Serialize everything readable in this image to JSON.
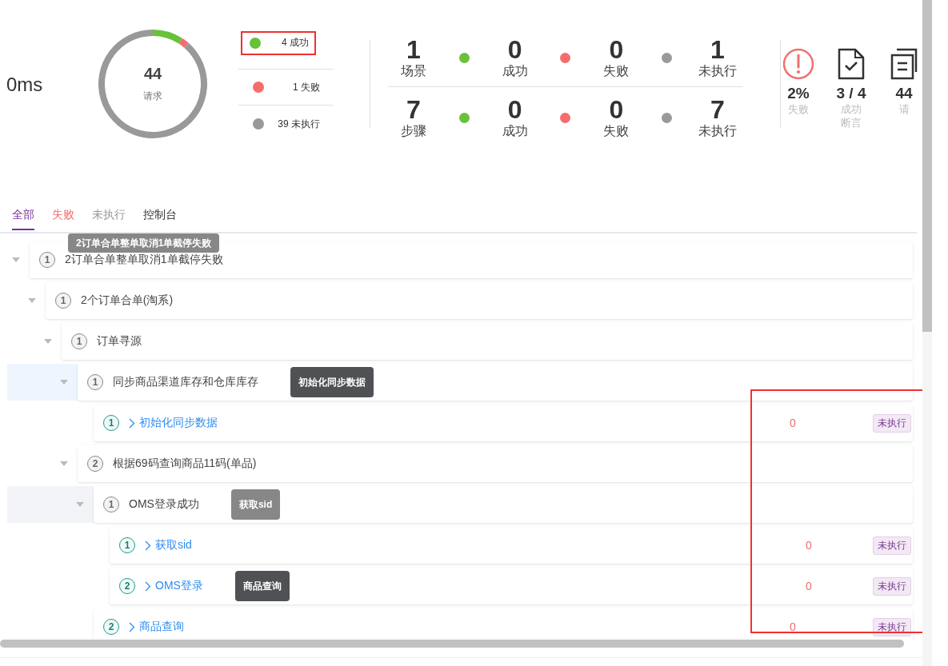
{
  "duration": "0ms",
  "request_chart": {
    "total": "44",
    "chart_data": {
      "type": "donut",
      "categories": [
        "4 成功",
        "1 失败",
        "39 未执行"
      ],
      "series": [
        {
          "name": "请求",
          "values": [
            4,
            1,
            39
          ]
        }
      ]
    }
  },
  "legend": [
    {
      "color": "#67c23a",
      "highlighted": true
    },
    {
      "color": "#f56c6c",
      "highlighted": false
    },
    {
      "color": "#999999",
      "highlighted": false
    }
  ],
  "stats": [
    [
      {
        "value": "1",
        "label": "场景"
      },
      {
        "value": "0",
        "label": "成功",
        "color": "#67c23a"
      },
      {
        "value": "0",
        "label": "失败",
        "color": "#f56c6c"
      },
      {
        "value": "1",
        "label": "未执行",
        "color": "#999999"
      }
    ],
    [
      {
        "value": "7",
        "label": "步骤"
      },
      {
        "value": "0",
        "label": "成功",
        "color": "#67c23a"
      },
      {
        "value": "0",
        "label": "失败",
        "color": "#f56c6c"
      },
      {
        "value": "7",
        "label": "未执行",
        "color": "#999999"
      }
    ]
  ],
  "summary": [
    {
      "kind": "alert",
      "value": "2%",
      "label": "失败"
    },
    {
      "kind": "file-check",
      "value": "3 / 4",
      "label": "成功断言"
    },
    {
      "kind": "clipboard",
      "value": "44",
      "label": "请"
    }
  ],
  "tabs": [
    {
      "label": "全部",
      "selected": true,
      "color": "#7b2fa0"
    },
    {
      "label": "失败",
      "selected": false,
      "color": "#f56c6c"
    },
    {
      "label": "未执行",
      "selected": false,
      "color": "#999999"
    },
    {
      "label": "控制台",
      "selected": false,
      "color": "#333333"
    }
  ],
  "highlight_result_column": true,
  "tree": [
    {
      "kind": "group",
      "number": "1",
      "title": "2订单合单整单取消1单截停失败",
      "expanded": true,
      "selected": false,
      "hovered": false,
      "tooltip": {
        "text": "2订单合单整单取消1单截停失败",
        "kind": "light"
      },
      "children": [
        {
          "kind": "group",
          "number": "1",
          "title": "2个订单合单(淘系)",
          "expanded": true,
          "selected": false,
          "hovered": false,
          "children": [
            {
              "kind": "group",
              "number": "1",
              "title": "订单寻源",
              "expanded": true,
              "selected": false,
              "hovered": false,
              "children": [
                {
                  "kind": "group",
                  "number": "1",
                  "title": "同步商品渠道库存和仓库库存",
                  "expanded": true,
                  "selected": true,
                  "hovered": false,
                  "tooltip": {
                    "text": "初始化同步数据",
                    "kind": "dark"
                  },
                  "children": [
                    {
                      "kind": "step",
                      "number": "1",
                      "title": "初始化同步数据",
                      "count": "0",
                      "status": "未执行"
                    }
                  ]
                },
                {
                  "kind": "group",
                  "number": "2",
                  "title": "根据69码查询商品11码(单品)",
                  "expanded": true,
                  "selected": false,
                  "hovered": false,
                  "children": [
                    {
                      "kind": "group",
                      "number": "1",
                      "title": "OMS登录成功",
                      "expanded": true,
                      "selected": false,
                      "hovered": true,
                      "tooltip": {
                        "text": "获取sid",
                        "kind": "light"
                      },
                      "children": [
                        {
                          "kind": "step",
                          "number": "1",
                          "title": "获取sid",
                          "count": "0",
                          "status": "未执行"
                        },
                        {
                          "kind": "step",
                          "number": "2",
                          "title": "OMS登录",
                          "count": "0",
                          "status": "未执行",
                          "tooltip": {
                            "text": "商品查询",
                            "kind": "dark"
                          }
                        }
                      ]
                    },
                    {
                      "kind": "step",
                      "number": "2",
                      "title": "商品查询",
                      "count": "0",
                      "status": "未执行"
                    }
                  ]
                }
              ]
            }
          ]
        }
      ]
    }
  ]
}
